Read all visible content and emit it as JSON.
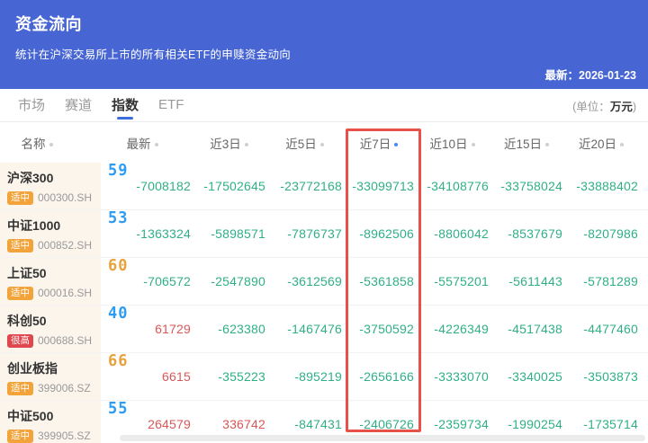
{
  "header": {
    "title": "资金流向",
    "subtitle": "统计在沪深交易所上市的所有相关ETF的申赎资金动向",
    "latest_date": "最新：2026-01-23"
  },
  "tabbar": {
    "tabs": [
      {
        "label": "市场"
      },
      {
        "label": "赛道"
      },
      {
        "label": "指数"
      },
      {
        "label": "ETF"
      }
    ],
    "active_tab": "指数",
    "unit_prefix": "(单位：",
    "unit_value": "万元",
    "unit_suffix": ")"
  },
  "table": {
    "columns": [
      "名称",
      "最新",
      "近3日",
      "近5日",
      "近7日",
      "近10日",
      "近15日",
      "近20日"
    ],
    "highlighted_column": "近7日",
    "colors": {
      "header_blue": "#4766D4",
      "negative": "#2FAF87",
      "positive": "#D95757",
      "score_blue": "#2D9CF4",
      "score_orange": "#E9A23B",
      "badge_medium": "#F2A33A",
      "badge_high": "#E0474D",
      "highlight_border": "#E8504A"
    },
    "rows": [
      {
        "name": "沪深300",
        "badge": "适中",
        "badge_type": "medium",
        "code": "000300.SH",
        "score": "59",
        "score_color": "blue",
        "values": [
          "-7008182",
          "-17502645",
          "-23772168",
          "-33099713",
          "-34108776",
          "-33758024",
          "-33888402"
        ]
      },
      {
        "name": "中证1000",
        "badge": "适中",
        "badge_type": "medium",
        "code": "000852.SH",
        "score": "53",
        "score_color": "blue",
        "values": [
          "-1363324",
          "-5898571",
          "-7876737",
          "-8962506",
          "-8806042",
          "-8537679",
          "-8207986"
        ]
      },
      {
        "name": "上证50",
        "badge": "适中",
        "badge_type": "medium",
        "code": "000016.SH",
        "score": "60",
        "score_color": "orange",
        "values": [
          "-706572",
          "-2547890",
          "-3612569",
          "-5361858",
          "-5575201",
          "-5611443",
          "-5781289"
        ]
      },
      {
        "name": "科创50",
        "badge": "很高",
        "badge_type": "high",
        "code": "000688.SH",
        "score": "40",
        "score_color": "blue",
        "values": [
          "61729",
          "-623380",
          "-1467476",
          "-3750592",
          "-4226349",
          "-4517438",
          "-4477460"
        ]
      },
      {
        "name": "创业板指",
        "badge": "适中",
        "badge_type": "medium",
        "code": "399006.SZ",
        "score": "66",
        "score_color": "orange",
        "values": [
          "6615",
          "-355223",
          "-895219",
          "-2656166",
          "-3333070",
          "-3340025",
          "-3503873"
        ]
      },
      {
        "name": "中证500",
        "badge": "适中",
        "badge_type": "medium",
        "code": "399905.SZ",
        "score": "55",
        "score_color": "blue",
        "values": [
          "264579",
          "336742",
          "-847431",
          "-2406726",
          "-2359734",
          "-1990254",
          "-1735714"
        ]
      }
    ]
  }
}
